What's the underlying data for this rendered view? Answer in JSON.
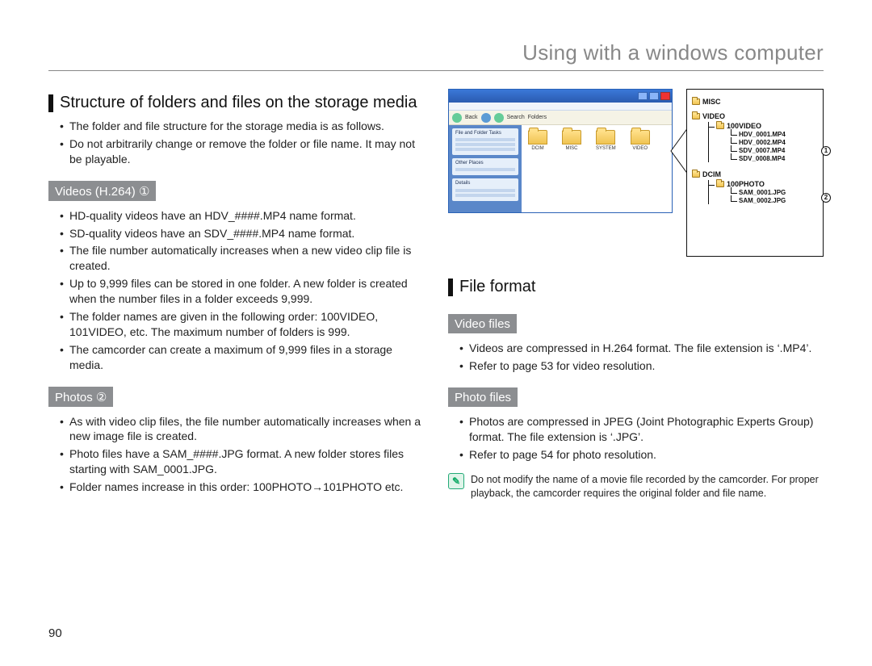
{
  "chapter_title": "Using with a windows computer",
  "page_number": "90",
  "left": {
    "section_title": "Structure of folders and files on the storage media",
    "intro": [
      "The folder and file structure for the storage media is as follows.",
      "Do not arbitrarily change or remove the folder or file name. It may not be playable."
    ],
    "videos_hdr": "Videos (H.264) ①",
    "videos": [
      "HD-quality videos have an HDV_####.MP4 name format.",
      "SD-quality videos have an SDV_####.MP4 name format.",
      "The file number automatically increases when a new video clip file is created.",
      "Up to 9,999 files can be stored in one folder. A new folder is created when the number files in a folder exceeds 9,999.",
      "The folder names are given in the following order: 100VIDEO, 101VIDEO, etc. The maximum number of folders is 999.",
      "The camcorder can create a maximum of 9,999 files in a storage media."
    ],
    "photos_hdr": "Photos ②",
    "photos": [
      "As with video clip files, the file number automatically increases when a new image file is created.",
      "Photo files have a SAM_####.JPG format. A new folder stores files starting with SAM_0001.JPG.",
      "Folder names increase in this order: 100PHOTO→101PHOTO etc."
    ]
  },
  "right": {
    "xp": {
      "toolbar": {
        "back": "Back",
        "search": "Search",
        "folders": "Folders"
      },
      "folders": {
        "a": "DCIM",
        "b": "MISC",
        "c": "SYSTEM",
        "d": "VIDEO"
      },
      "side_panels": {
        "tasks": "File and Folder Tasks",
        "other": "Other Places",
        "details": "Details"
      }
    },
    "tree": {
      "misc": "MISC",
      "video": "VIDEO",
      "video_sub": "100VIDEO",
      "video_files": [
        "HDV_0001.MP4",
        "HDV_0002.MP4",
        "SDV_0007.MP4",
        "SDV_0008.MP4"
      ],
      "dcim": "DCIM",
      "dcim_sub": "100PHOTO",
      "dcim_files": [
        "SAM_0001.JPG",
        "SAM_0002.JPG"
      ],
      "mark1": "1",
      "mark2": "2"
    },
    "file_format_hdr": "File format",
    "video_files_hdr": "Video files",
    "video_files": [
      "Videos are compressed in H.264 format. The file extension is ‘.MP4’.",
      "Refer to page 53 for video resolution."
    ],
    "photo_files_hdr": "Photo files",
    "photo_files": [
      "Photos are compressed in JPEG (Joint Photographic Experts Group) format. The file extension is ‘.JPG’.",
      "Refer to page 54 for photo resolution."
    ],
    "note_icon": "✎",
    "note": "Do not modify the name of a movie file recorded by the camcorder. For proper playback, the camcorder requires the original folder and file name."
  }
}
